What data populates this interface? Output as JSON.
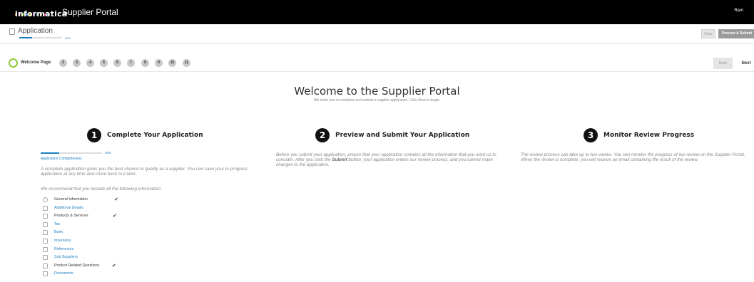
{
  "header": {
    "logo_text": "informatica",
    "portal_title": "Supplier Portal",
    "user_name": "Ram",
    "logo_dot_colors": [
      "#f5a623",
      "#e94e77",
      "#7ed321",
      "#4a90e2",
      "#f8e71c",
      "#bd10e0",
      "#50e3c2",
      "#f5a623",
      "#e94e77",
      "#4a90e2"
    ]
  },
  "application": {
    "title": "Application",
    "progress_percent": 30,
    "progress_label": "30%",
    "save_label": "Save",
    "preview_label": "Preview & Submit"
  },
  "steps": {
    "current_label": "Welcome Page",
    "numbers": [
      "2",
      "3",
      "4",
      "5",
      "6",
      "7",
      "8",
      "9",
      "10",
      "11"
    ],
    "back_label": "Back",
    "next_label": "Next"
  },
  "welcome": {
    "title": "Welcome to the Supplier Portal",
    "subtitle": "We invite you to complete and submit a supplier application. Click Next to begin."
  },
  "columns": [
    {
      "number": "1",
      "title": "Complete Your Application",
      "completeness_label": "Application Completeness",
      "completeness_percent": 30,
      "completeness_pct_label": "30%",
      "text1": "A complete application gives you the best chance to qualify as a supplier. You can save your in-progress application at any time and come back to it later.",
      "text2": "We recommend that you include all the following information:"
    },
    {
      "number": "2",
      "title": "Preview and Submit Your Application",
      "text_before": "Before you submit your application, ensure that your application contains all the information that you want us to consider. After you click the ",
      "text_bold": "Submit",
      "text_after": " button, your application enters our review process, and you cannot make changes to the application."
    },
    {
      "number": "3",
      "title": "Monitor Review Progress",
      "text": "The review process can take up to two weeks. You can monitor the progress of our review on the Supplier Portal. When the review is complete, you will receive an email containing the result of the review."
    }
  ],
  "info_items": [
    {
      "label": "General Information",
      "complete": true,
      "icon": "person-icon"
    },
    {
      "label": "Additional Details",
      "complete": false,
      "icon": "details-icon"
    },
    {
      "label": "Products & Services",
      "complete": true,
      "icon": "products-icon"
    },
    {
      "label": "Tax",
      "complete": false,
      "icon": "tax-icon"
    },
    {
      "label": "Bank",
      "complete": false,
      "icon": "bank-icon"
    },
    {
      "label": "Insurance",
      "complete": false,
      "icon": "insurance-icon"
    },
    {
      "label": "References",
      "complete": false,
      "icon": "references-icon"
    },
    {
      "label": "Sub Suppliers",
      "complete": false,
      "icon": "sub-suppliers-icon"
    },
    {
      "label": "Product Related Questions",
      "complete": true,
      "icon": "questions-icon"
    },
    {
      "label": "Documents",
      "complete": false,
      "icon": "documents-icon"
    }
  ],
  "check_glyph": "✔"
}
